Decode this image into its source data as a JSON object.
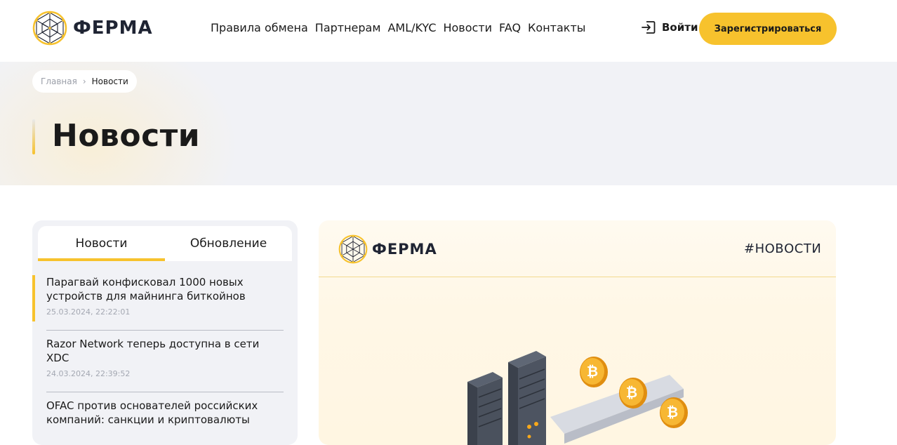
{
  "header": {
    "logo_text": "ФЕРМА",
    "nav": [
      {
        "label": "Правила обмена"
      },
      {
        "label": "Партнерам"
      },
      {
        "label": "AML/KYC"
      },
      {
        "label": "Новости"
      },
      {
        "label": "FAQ"
      },
      {
        "label": "Контакты"
      }
    ],
    "login_label": "Войти",
    "register_label": "Зарегистрироваться"
  },
  "breadcrumb": {
    "home": "Главная",
    "separator": "›",
    "current": "Новости"
  },
  "page_title": "Новости",
  "sidebar": {
    "tabs": [
      {
        "label": "Новости",
        "active": true
      },
      {
        "label": "Обновление",
        "active": false
      }
    ],
    "news": [
      {
        "title": "Парагвай конфисковал 1000 новых устройств для майнинга биткойнов",
        "date": "25.03.2024, 22:22:01"
      },
      {
        "title": "Razor Network теперь доступна в сети XDC",
        "date": "24.03.2024, 22:39:52"
      },
      {
        "title": "OFAC против основателей российских компаний: санкции и криптовалюты",
        "date": ""
      }
    ]
  },
  "article": {
    "logo_text": "ФЕРМА",
    "tag": "#НОВОСТИ",
    "coin_symbol": "₿"
  },
  "colors": {
    "accent": "#f7c22d",
    "hero_bg": "#f1f2f6",
    "text": "#1a1a1a",
    "muted": "#a4a8b2"
  }
}
